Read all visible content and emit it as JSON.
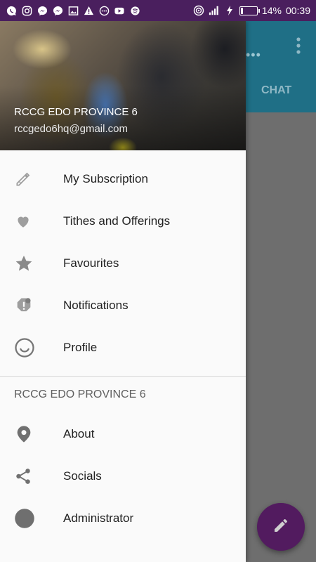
{
  "status_bar": {
    "left_icons": [
      "messaging-icon",
      "instagram-icon",
      "messenger-icon",
      "messenger-icon",
      "image-icon",
      "warning-icon",
      "chat-bubble-icon",
      "youtube-icon",
      "music-icon"
    ],
    "battery": "14%",
    "time": "00:39",
    "battery_level": 0.14
  },
  "background_app": {
    "tab_label": "CHAT",
    "toolbar_color": "#1f6f86",
    "fab_color": "#521b5f"
  },
  "drawer": {
    "header": {
      "name": "RCCG EDO PROVINCE 6",
      "email": "rccgedo6hq@gmail.com"
    },
    "items": [
      {
        "label": "My Subscription",
        "icon": "pencil-icon"
      },
      {
        "label": "Tithes and Offerings",
        "icon": "heart-icon"
      },
      {
        "label": "Favourites",
        "icon": "star-icon"
      },
      {
        "label": "Notifications",
        "icon": "notification-icon"
      },
      {
        "label": "Profile",
        "icon": "smiley-icon"
      }
    ],
    "section_title": "RCCG EDO PROVINCE 6",
    "section_items": [
      {
        "label": "About",
        "icon": "location-pin-icon"
      },
      {
        "label": "Socials",
        "icon": "share-icon"
      },
      {
        "label": "Administrator",
        "icon": "circle-icon"
      }
    ]
  }
}
